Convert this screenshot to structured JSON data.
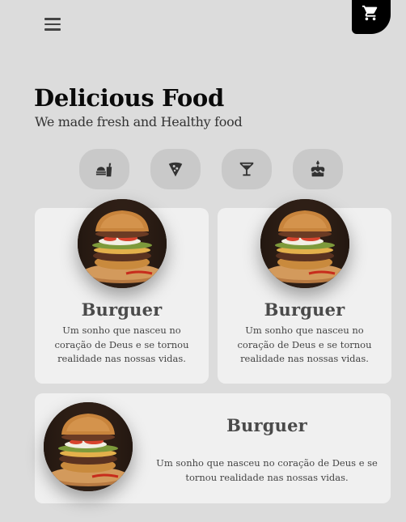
{
  "header": {
    "menu_icon": "hamburger-menu-icon",
    "cart_icon": "shopping-cart-icon"
  },
  "hero": {
    "title": "Delicious Food",
    "subtitle": "We made fresh and Healthy food"
  },
  "categories": [
    {
      "icon": "fast-food-icon"
    },
    {
      "icon": "pizza-slice-icon"
    },
    {
      "icon": "cocktail-glass-icon"
    },
    {
      "icon": "birthday-cake-icon"
    }
  ],
  "products": [
    {
      "title": "Burguer",
      "description": "Um sonho que nasceu no coração de Deus e se tornou realidade nas nossas vidas.",
      "image_icon": "burger-photo"
    },
    {
      "title": "Burguer",
      "description": "Um sonho que nasceu no coração de Deus e se tornou realidade nas nossas vidas.",
      "image_icon": "burger-photo"
    },
    {
      "title": "Burguer",
      "description": "Um sonho que nasceu no coração de Deus e se tornou realidade nas nossas vidas.",
      "image_icon": "burger-photo"
    }
  ],
  "colors": {
    "background": "#dcdcdc",
    "card": "#f0f0f0",
    "category_button": "#c9c9c9",
    "cart_button": "#000000"
  }
}
